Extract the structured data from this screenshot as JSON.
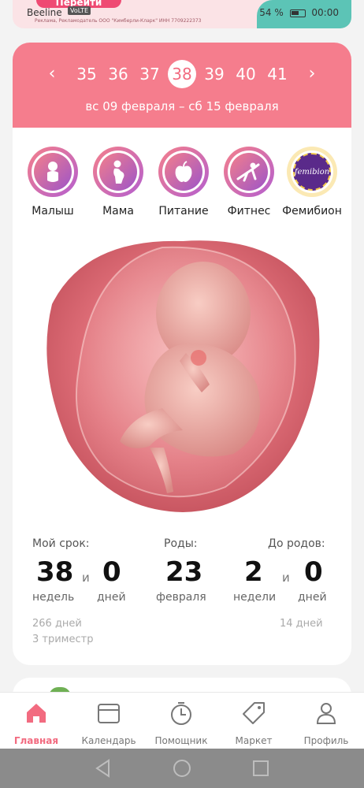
{
  "status_bar": {
    "carrier": "Beeline",
    "badges": "VoLTE",
    "battery": "54 %",
    "time": "00:00"
  },
  "ad": {
    "button_label": "Перейти",
    "disclaimer": "Реклама, Рекламодатель ООО \"Кимберли-Кларк\" ИНН 7709222373"
  },
  "week_selector": {
    "weeks": [
      "35",
      "36",
      "37",
      "38",
      "39",
      "40",
      "41"
    ],
    "active_week": "38",
    "date_range": "вс 09 февраля – сб 15 февраля"
  },
  "categories": [
    {
      "label": "Малыш",
      "icon": "baby-icon"
    },
    {
      "label": "Мама",
      "icon": "pregnant-woman-icon"
    },
    {
      "label": "Питание",
      "icon": "apple-icon"
    },
    {
      "label": "Фитнес",
      "icon": "fitness-icon"
    },
    {
      "label": "Фемибион",
      "icon": "femibion-logo",
      "logo_text": "femibion"
    }
  ],
  "stats": {
    "term": {
      "label": "Мой срок:",
      "weeks": "38",
      "weeks_unit": "недель",
      "and": "и",
      "days": "0",
      "days_unit": "дней"
    },
    "birth": {
      "label": "Роды:",
      "day": "23",
      "month": "февраля"
    },
    "remaining": {
      "label": "До родов:",
      "weeks": "2",
      "weeks_unit": "недели",
      "and": "и",
      "days": "0",
      "days_unit": "дней"
    },
    "total_days": "266 дней",
    "trimester": "3 триместр",
    "days_left": "14 дней"
  },
  "bottom_nav": [
    {
      "label": "Главная",
      "icon": "home-icon",
      "active": true
    },
    {
      "label": "Календарь",
      "icon": "calendar-icon"
    },
    {
      "label": "Помощник",
      "icon": "timer-icon"
    },
    {
      "label": "Маркет",
      "icon": "tag-icon"
    },
    {
      "label": "Профиль",
      "icon": "profile-icon"
    }
  ],
  "colors": {
    "accent": "#f26b80",
    "header": "#f57d8d"
  }
}
